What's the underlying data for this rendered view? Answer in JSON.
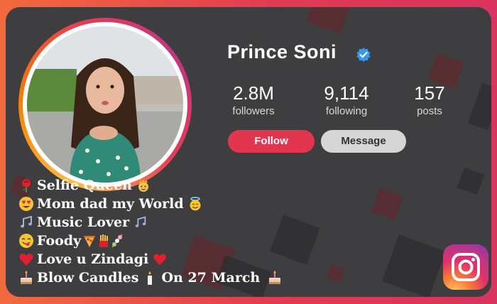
{
  "profile": {
    "name": "Prince Soni",
    "verified": true,
    "stats": [
      {
        "value": "2.8M",
        "label": "followers"
      },
      {
        "value": "9,114",
        "label": "following"
      },
      {
        "value": "157",
        "label": "posts"
      }
    ],
    "buttons": {
      "follow": "Follow",
      "message": "Message"
    }
  },
  "bio": [
    {
      "text": "Selfie Queen",
      "lead_icon": "rose-icon",
      "trail_icon": "princess-icon"
    },
    {
      "text": "Mom dad my World",
      "lead_icon": "heart-eyes-icon",
      "trail_icon": "halo-smile-icon"
    },
    {
      "text": "Music Lover",
      "lead_icon": "music-notes-icon",
      "trail_icon": "music-notes-icon"
    },
    {
      "text": "Foody",
      "lead_icon": "yum-face-icon",
      "trail_icon": "pizza-fries-dango-icons"
    },
    {
      "text": "Love u Zindagi",
      "lead_icon": "heart-icon",
      "trail_icon": "heart-icon"
    },
    {
      "text": "Blow Candles",
      "text2": "On 27 March",
      "lead_icon": "cake-icon",
      "mid_icon": "candle-icon",
      "trail_icon": "cake-icon"
    }
  ],
  "colors": {
    "frame_gradient_start": "#f26a3d",
    "frame_gradient_end": "#d8345f",
    "card_bg": "#3e3d3f",
    "follow_button": "#e2354f",
    "message_button": "#d6d6d6",
    "verified_badge": "#3897f0"
  },
  "logo": "instagram-logo"
}
